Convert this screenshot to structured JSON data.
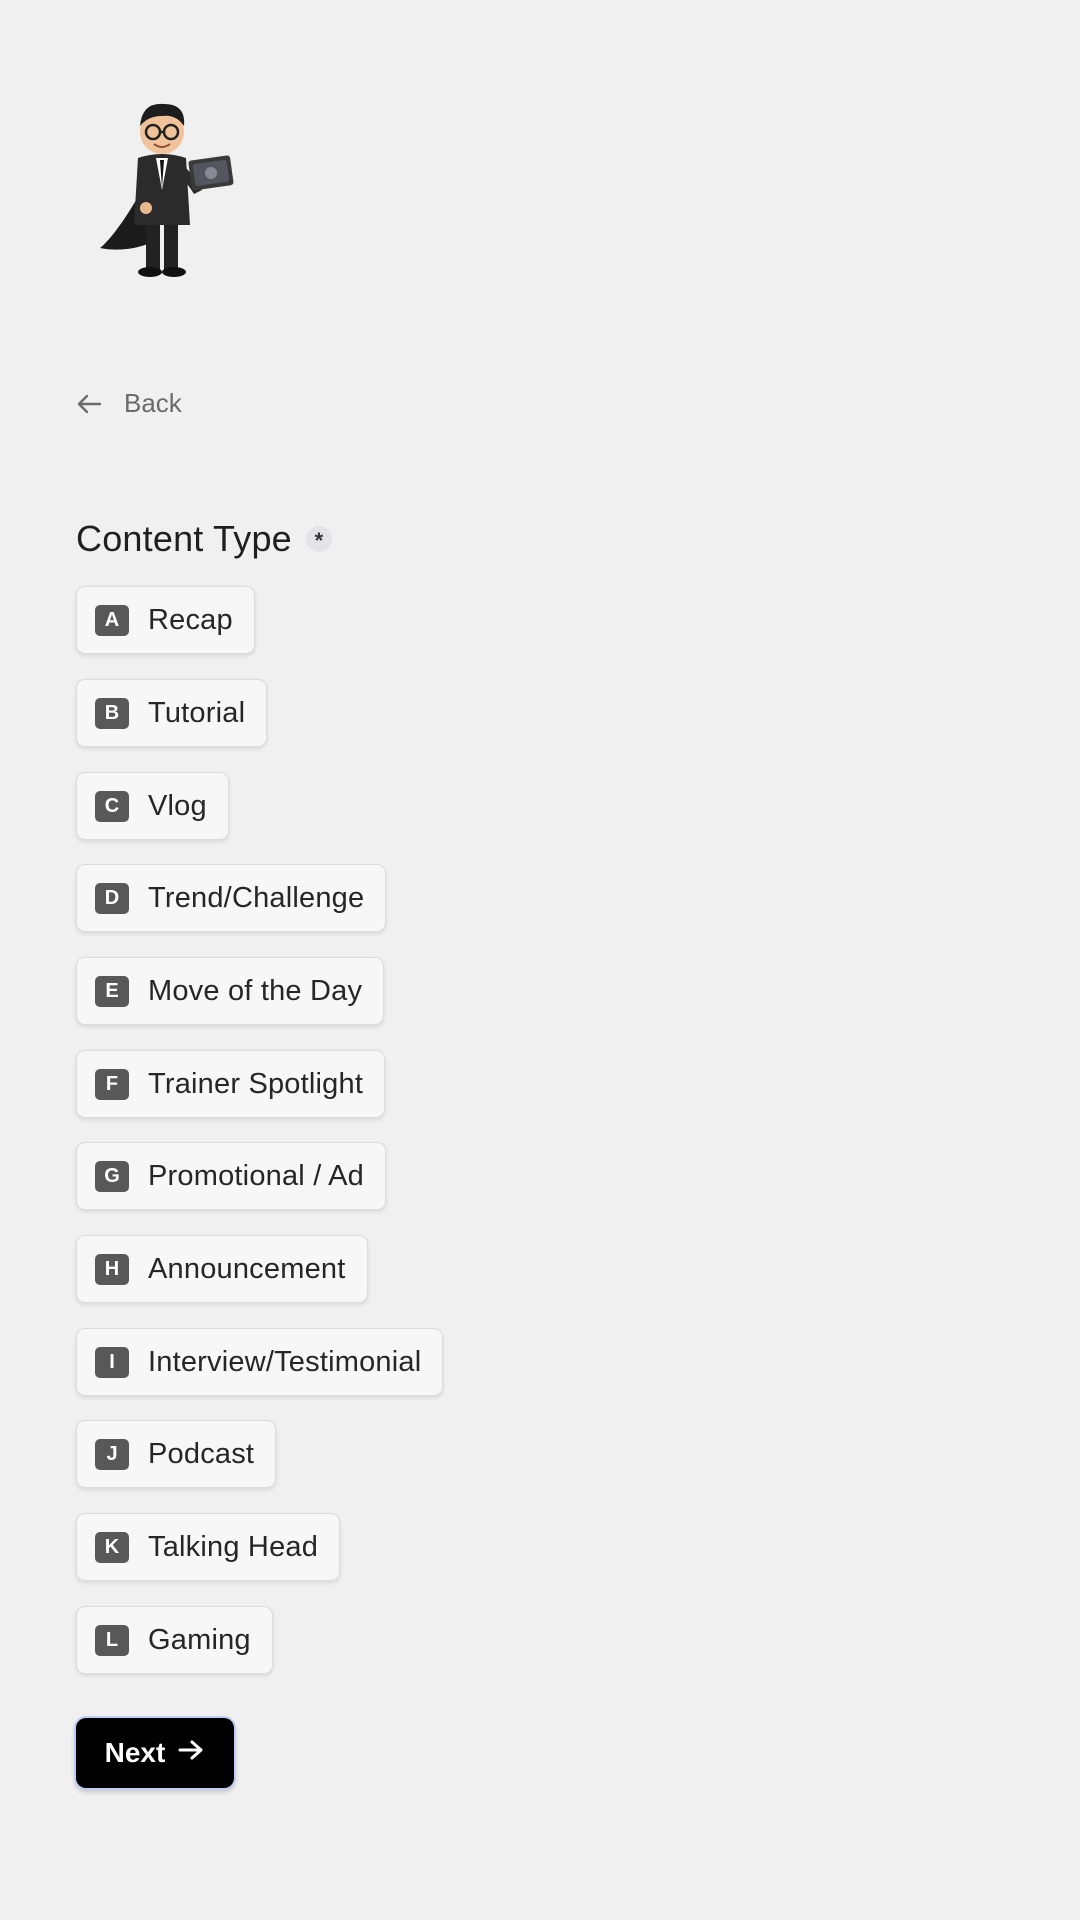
{
  "back": {
    "label": "Back",
    "icon": "arrow-left-icon"
  },
  "question": {
    "title": "Content Type",
    "required_marker": "*"
  },
  "options": [
    {
      "key": "A",
      "label": "Recap"
    },
    {
      "key": "B",
      "label": "Tutorial"
    },
    {
      "key": "C",
      "label": "Vlog"
    },
    {
      "key": "D",
      "label": "Trend/Challenge"
    },
    {
      "key": "E",
      "label": "Move of the Day"
    },
    {
      "key": "F",
      "label": "Trainer Spotlight"
    },
    {
      "key": "G",
      "label": "Promotional / Ad"
    },
    {
      "key": "H",
      "label": "Announcement"
    },
    {
      "key": "I",
      "label": "Interview/Testimonial"
    },
    {
      "key": "J",
      "label": "Podcast"
    },
    {
      "key": "K",
      "label": "Talking Head"
    },
    {
      "key": "L",
      "label": "Gaming"
    }
  ],
  "next_button": {
    "label": "Next",
    "icon": "arrow-right-icon"
  },
  "colors": {
    "background": "#f0f0f1",
    "option_background": "#f7f7f8",
    "key_badge": "#585858",
    "button": "#000000",
    "button_focus_ring": "#bcd0f2"
  }
}
